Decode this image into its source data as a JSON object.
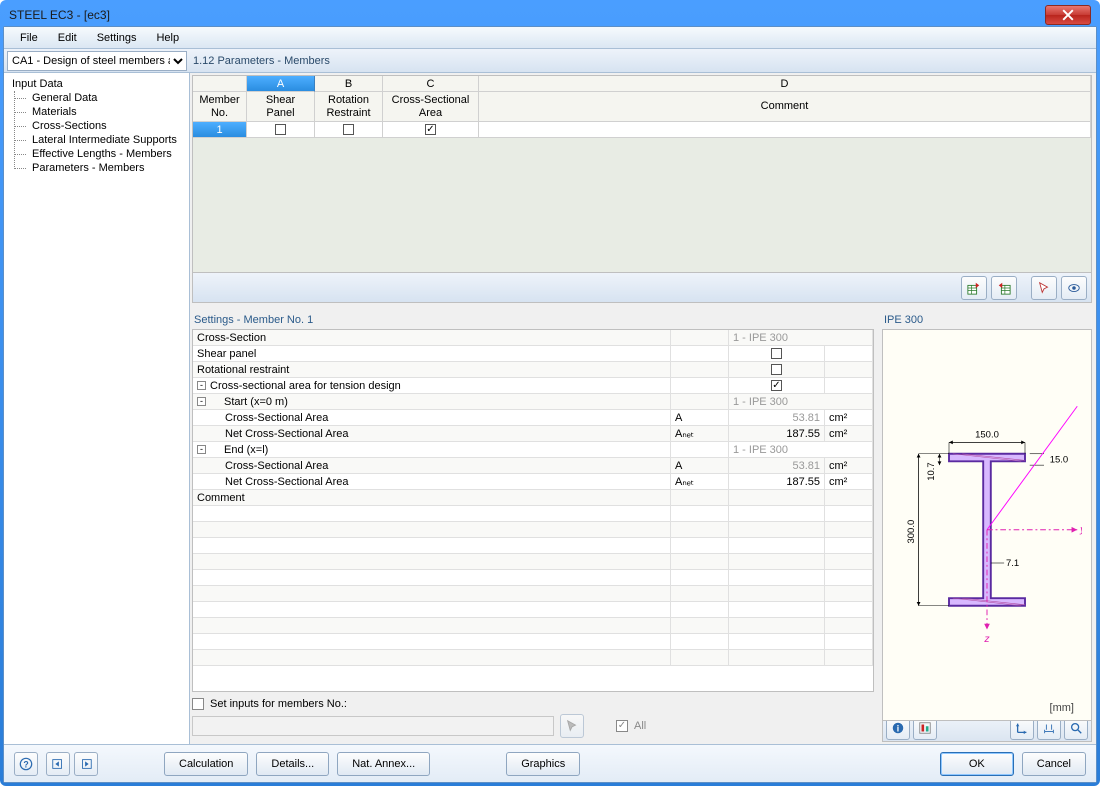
{
  "window": {
    "title": "STEEL EC3 - [ec3]"
  },
  "menu": {
    "file": "File",
    "edit": "Edit",
    "settings": "Settings",
    "help": "Help"
  },
  "topbar": {
    "case_selector": "CA1 - Design of steel members a",
    "panel_title": "1.12 Parameters - Members"
  },
  "tree": {
    "root": "Input Data",
    "items": [
      "General Data",
      "Materials",
      "Cross-Sections",
      "Lateral Intermediate Supports",
      "Effective Lengths - Members",
      "Parameters - Members"
    ]
  },
  "grid": {
    "col_member_no": "Member\nNo.",
    "col_A_letter": "A",
    "col_A_label": "Shear\nPanel",
    "col_B_letter": "B",
    "col_B_label": "Rotation\nRestraint",
    "col_C_letter": "C",
    "col_C_label": "Cross-Sectional\nArea",
    "col_D_letter": "D",
    "col_D_label": "Comment",
    "row1": {
      "no": "1",
      "shear": false,
      "rot": false,
      "csa": true,
      "comment": ""
    }
  },
  "settings": {
    "title": "Settings - Member No. 1",
    "rows": [
      {
        "label": "Cross-Section",
        "sym": "",
        "val": "1 - IPE 300",
        "unit": "",
        "dim": true,
        "span": true,
        "valcol": 2
      },
      {
        "label": "Shear panel",
        "sym": "",
        "check": false
      },
      {
        "label": "Rotational restraint",
        "sym": "",
        "check": false
      },
      {
        "label": "Cross-sectional area for tension design",
        "exp": "-",
        "check": true
      },
      {
        "label": "Start (x=0 m)",
        "exp": "-",
        "indent": 1,
        "val": "1 - IPE 300",
        "dim": true,
        "valcol": 2
      },
      {
        "label": "Cross-Sectional Area",
        "indent": 2,
        "sym": "A",
        "val": "53.81",
        "unit": "cm²",
        "dim_num": true
      },
      {
        "label": "Net Cross-Sectional Area",
        "indent": 2,
        "sym": "Aₙₑₜ",
        "val": "187.55",
        "unit": "cm²"
      },
      {
        "label": "End (x=l)",
        "exp": "-",
        "indent": 1,
        "val": "1 - IPE 300",
        "dim": true,
        "valcol": 2
      },
      {
        "label": "Cross-Sectional Area",
        "indent": 2,
        "sym": "A",
        "val": "53.81",
        "unit": "cm²",
        "dim_num": true
      },
      {
        "label": "Net Cross-Sectional Area",
        "indent": 2,
        "sym": "Aₙₑₜ",
        "val": "187.55",
        "unit": "cm²"
      },
      {
        "label": "Comment",
        "sym": "",
        "val": "",
        "unit": ""
      }
    ]
  },
  "bottom": {
    "set_inputs_label": "Set inputs for members No.:",
    "all_label": "All",
    "all_checked": true
  },
  "preview": {
    "title": "IPE 300",
    "unit": "[mm]",
    "dims": {
      "b": "150.0",
      "tf": "15.0",
      "tw_top": "10.7",
      "tw": "7.1",
      "h": "300.0",
      "y": "y",
      "z": "z"
    }
  },
  "footer": {
    "calc": "Calculation",
    "details": "Details...",
    "nat": "Nat. Annex...",
    "graphics": "Graphics",
    "ok": "OK",
    "cancel": "Cancel"
  }
}
